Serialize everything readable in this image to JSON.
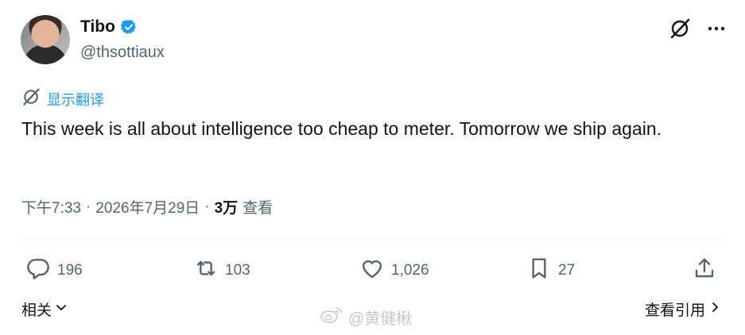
{
  "author": {
    "name": "Tibo",
    "handle": "@thsottiaux"
  },
  "translate": {
    "label": "显示翻译"
  },
  "tweet": {
    "text": "This week is all about intelligence too cheap to meter. Tomorrow we ship again."
  },
  "meta": {
    "time": "下午7:33",
    "separator1": "·",
    "date": "2026年7月29日",
    "separator2": "·",
    "views_count": "3万",
    "views_label": "查看"
  },
  "actions": {
    "replies": "196",
    "retweets": "103",
    "likes": "1,026",
    "bookmarks": "27"
  },
  "footer": {
    "related_label": "相关",
    "quotes_label": "查看引用",
    "watermark": "@黄健楸"
  },
  "colors": {
    "accent": "#1d9bf0",
    "text": "#0f1419",
    "secondary": "#536471"
  }
}
